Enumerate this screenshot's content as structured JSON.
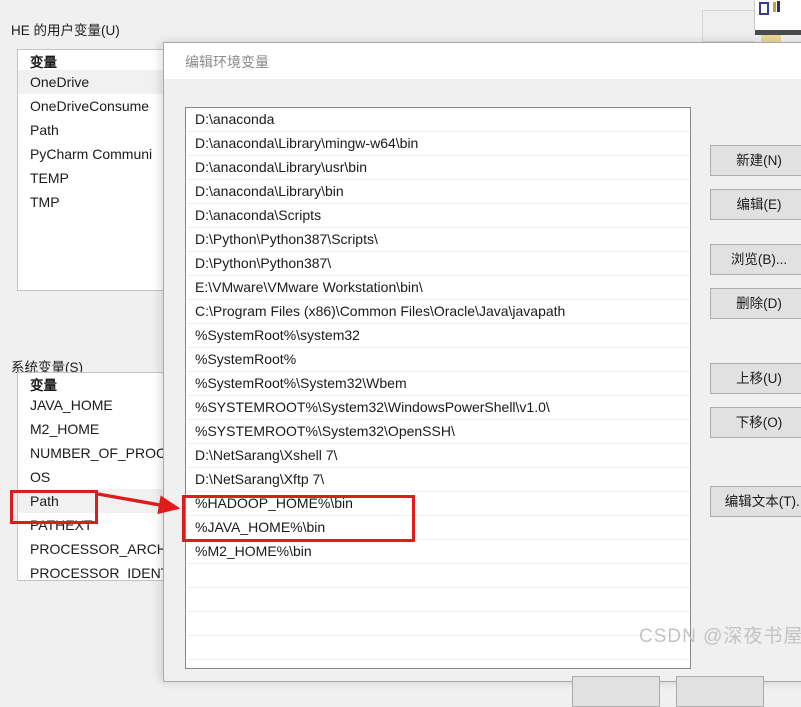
{
  "window": {
    "user_vars_group_label": "HE 的用户变量(U)",
    "system_vars_group_label": "系统变量(S)",
    "column_header": "变量"
  },
  "user_variables": {
    "header": "变量",
    "rows": [
      {
        "name": "OneDrive",
        "selected": true
      },
      {
        "name": "OneDriveConsume",
        "selected": false
      },
      {
        "name": "Path",
        "selected": false
      },
      {
        "name": "PyCharm Communi",
        "selected": false
      },
      {
        "name": "TEMP",
        "selected": false
      },
      {
        "name": "TMP",
        "selected": false
      }
    ]
  },
  "system_variables": {
    "header": "变量",
    "rows": [
      {
        "name": "JAVA_HOME",
        "selected": false
      },
      {
        "name": "M2_HOME",
        "selected": false
      },
      {
        "name": "NUMBER_OF_PROC",
        "selected": false
      },
      {
        "name": "OS",
        "selected": false
      },
      {
        "name": "Path",
        "selected": true
      },
      {
        "name": "PATHEXT",
        "selected": false
      },
      {
        "name": "PROCESSOR_ARCH",
        "selected": false
      },
      {
        "name": "PROCESSOR_IDENT",
        "selected": false
      }
    ]
  },
  "dialog": {
    "title": "编辑环境变量",
    "path_entries": [
      "D:\\anaconda",
      "D:\\anaconda\\Library\\mingw-w64\\bin",
      "D:\\anaconda\\Library\\usr\\bin",
      "D:\\anaconda\\Library\\bin",
      "D:\\anaconda\\Scripts",
      "D:\\Python\\Python387\\Scripts\\",
      "D:\\Python\\Python387\\",
      "E:\\VMware\\VMware Workstation\\bin\\",
      "C:\\Program Files (x86)\\Common Files\\Oracle\\Java\\javapath",
      "%SystemRoot%\\system32",
      "%SystemRoot%",
      "%SystemRoot%\\System32\\Wbem",
      "%SYSTEMROOT%\\System32\\WindowsPowerShell\\v1.0\\",
      "%SYSTEMROOT%\\System32\\OpenSSH\\",
      "D:\\NetSarang\\Xshell 7\\",
      "D:\\NetSarang\\Xftp 7\\",
      "%HADOOP_HOME%\\bin",
      "%JAVA_HOME%\\bin",
      "%M2_HOME%\\bin"
    ],
    "buttons": {
      "new": "新建(N)",
      "edit": "编辑(E)",
      "browse": "浏览(B)...",
      "delete": "删除(D)",
      "move_up": "上移(U)",
      "move_down": "下移(O)",
      "edit_text": "编辑文本(T)..."
    }
  },
  "annotations": {
    "highlight_color": "#e01b1b",
    "highlighted_system_variable": "Path",
    "highlighted_path_entries": [
      "%HADOOP_HOME%\\bin",
      "%JAVA_HOME%\\bin"
    ]
  },
  "watermark": {
    "text": "CSDN @深夜书屋"
  }
}
